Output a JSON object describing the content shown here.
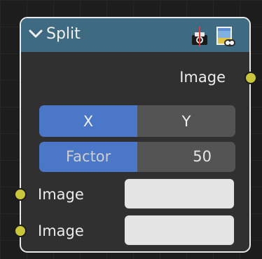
{
  "node": {
    "title": "Split",
    "output_label": "Image",
    "axis": {
      "options": [
        "X",
        "Y"
      ],
      "selected": "X"
    },
    "factor": {
      "label": "Factor",
      "value": "50",
      "fraction": 0.5
    },
    "inputs": [
      {
        "label": "Image",
        "color": "#e5e5e5"
      },
      {
        "label": "Image",
        "color": "#e5e5e5"
      }
    ],
    "icons": {
      "collapse": "chevron-down-icon",
      "render": "camera-render-icon",
      "preview": "image-preview-icon"
    },
    "colors": {
      "header": "#3e6b82",
      "accent": "#4a77c7",
      "socket": "#c9c63b"
    }
  }
}
